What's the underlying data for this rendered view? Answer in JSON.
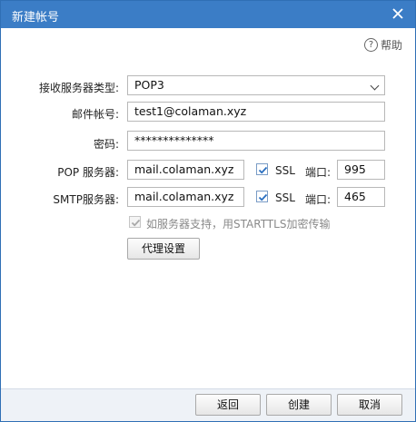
{
  "window": {
    "title": "新建帐号"
  },
  "help": {
    "label": "帮助"
  },
  "form": {
    "server_type_label": "接收服务器类型:",
    "server_type_value": "POP3",
    "email_label": "邮件帐号:",
    "email_value": "test1@colaman.xyz",
    "password_label": "密码:",
    "password_value": "**************",
    "pop_label": "POP 服务器:",
    "pop_value": "mail.colaman.xyz",
    "pop_ssl_label": "SSL",
    "pop_ssl_checked": true,
    "pop_port_label": "端口:",
    "pop_port_value": "995",
    "smtp_label": "SMTP服务器:",
    "smtp_value": "mail.colaman.xyz",
    "smtp_ssl_label": "SSL",
    "smtp_ssl_checked": true,
    "smtp_port_label": "端口:",
    "smtp_port_value": "465",
    "starttls_label": "如服务器支持，用STARTTLS加密传输",
    "starttls_checked": true,
    "starttls_enabled": false,
    "proxy_button": "代理设置"
  },
  "footer": {
    "back_button": "返回",
    "create_button": "创建",
    "cancel_button": "取消"
  },
  "colors": {
    "titlebar": "#3b7dc6",
    "check": "#2a6fc0",
    "footer": "#eef2f7"
  }
}
